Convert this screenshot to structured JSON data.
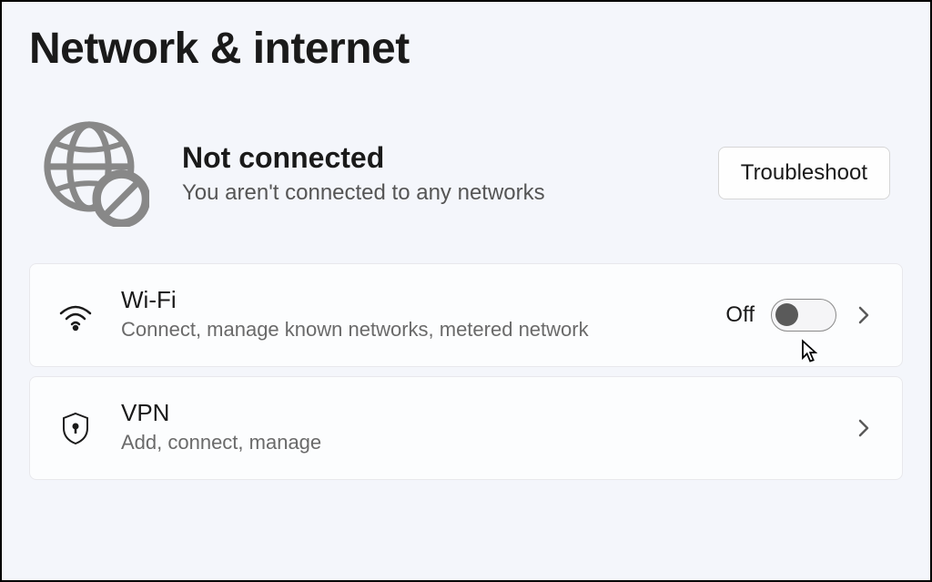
{
  "page": {
    "title": "Network & internet"
  },
  "status": {
    "title": "Not connected",
    "subtitle": "You aren't connected to any networks",
    "troubleshoot_label": "Troubleshoot"
  },
  "items": {
    "wifi": {
      "title": "Wi-Fi",
      "subtitle": "Connect, manage known networks, metered network",
      "toggle_state": "Off"
    },
    "vpn": {
      "title": "VPN",
      "subtitle": "Add, connect, manage"
    }
  }
}
